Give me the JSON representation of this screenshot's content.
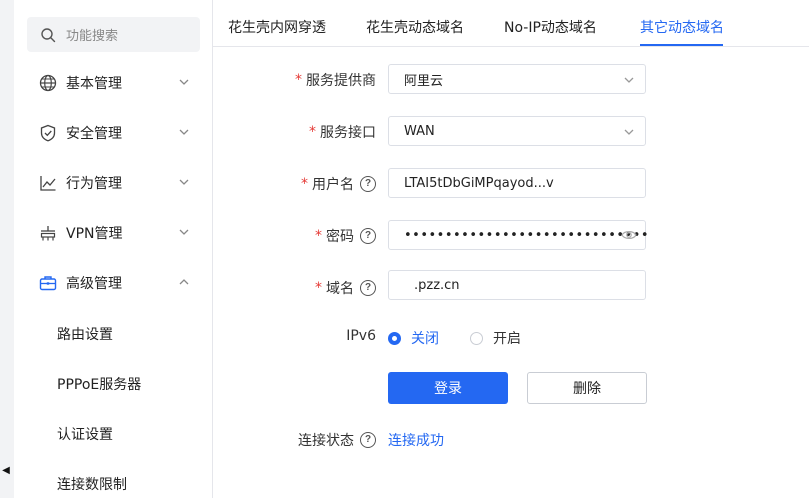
{
  "sidebar": {
    "search_placeholder": "功能搜索",
    "menu": [
      {
        "label": "基本管理",
        "icon": "globe-icon",
        "expanded": false
      },
      {
        "label": "安全管理",
        "icon": "shield-check-icon",
        "expanded": false
      },
      {
        "label": "行为管理",
        "icon": "line-chart-icon",
        "expanded": false
      },
      {
        "label": "VPN管理",
        "icon": "network-icon",
        "expanded": false
      },
      {
        "label": "高级管理",
        "icon": "briefcase-icon",
        "expanded": true
      }
    ],
    "submenu": [
      "路由设置",
      "PPPoE服务器",
      "认证设置",
      "连接数限制"
    ]
  },
  "tabs": [
    {
      "label": "花生壳内网穿透",
      "active": false
    },
    {
      "label": "花生壳动态域名",
      "active": false
    },
    {
      "label": "No-IP动态域名",
      "active": false
    },
    {
      "label": "其它动态域名",
      "active": true
    }
  ],
  "form": {
    "provider_label": "服务提供商",
    "provider_value": "阿里云",
    "interface_label": "服务接口",
    "interface_value": "WAN",
    "username_label": "用户名",
    "username_value": "LTAI5tDbGiMPqayod...v",
    "password_label": "密码",
    "password_value": "••••••••••••••••••••••••••••••",
    "domain_label": "域名",
    "domain_value": ".pzz.cn",
    "ipv6_label": "IPv6",
    "ipv6_options": [
      {
        "label": "关闭",
        "selected": true
      },
      {
        "label": "开启",
        "selected": false
      }
    ],
    "login_button": "登录",
    "delete_button": "删除",
    "status_label": "连接状态",
    "status_value": "连接成功"
  },
  "colors": {
    "accent": "#2468f2",
    "required": "#e53935"
  }
}
